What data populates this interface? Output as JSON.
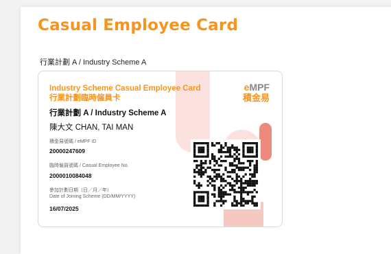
{
  "page": {
    "title": "Casual Employee Card",
    "scheme_label": "行業計劃 A  / Industry Scheme A"
  },
  "card": {
    "heading_en": "Industry Scheme Casual Employee Card",
    "heading_zh": "行業計劃臨時僱員卡",
    "scheme": "行業計劃 A  / Industry Scheme A",
    "name": "陳大文   CHAN, TAI MAN",
    "logo": {
      "top_prefix": "e",
      "top_rest": "MPF",
      "bottom": "積金易"
    },
    "fields": [
      {
        "label": "積金易號碼 / eMPF ID",
        "value": "20000247609"
      },
      {
        "label": "臨時僱員號碼 / Casual Employee No.",
        "value": "2000010084048"
      },
      {
        "label_line1": "參加計劃日期（日／月／年）",
        "label_line2": "Date of Joining Scheme (DD/MM/YYYY)",
        "value": "16/07/2025"
      }
    ],
    "qr_icon": "qr-code"
  },
  "colors": {
    "accent": "#f7941d",
    "deco_light": "#fbe2de",
    "deco_dark": "#ec8b7d"
  }
}
